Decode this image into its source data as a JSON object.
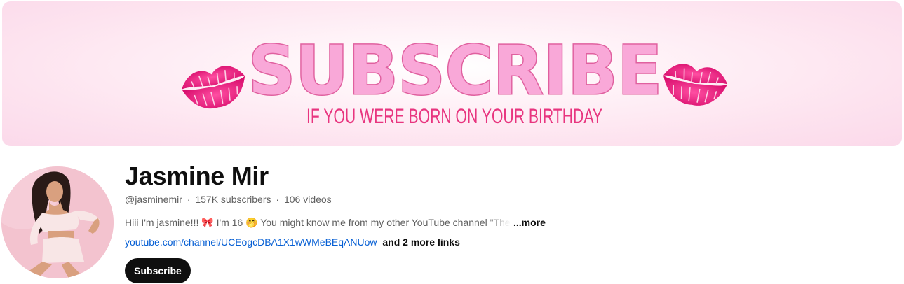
{
  "banner": {
    "headline": "SUBSCRIBE",
    "tagline": "IF YOU WERE BORN ON YOUR BIRTHDAY",
    "colors": {
      "headline_fill": "#f9a8d8",
      "headline_outline": "#e0609f",
      "tagline": "#e8357f",
      "lips": "#e8227e"
    },
    "icons": [
      "lips-icon",
      "lips-icon"
    ]
  },
  "channel": {
    "name": "Jasmine Mir",
    "handle": "@jasminemir",
    "subscribers": "157K subscribers",
    "videos": "106 videos",
    "separator": "·"
  },
  "description": {
    "text": "Hiii I'm jasmine!!! 🎀 I'm 16 🤭 You might know me from my other YouTube channel \"The",
    "more_label": "...more"
  },
  "links": {
    "primary": "youtube.com/channel/UCEogcDBA1X1wWMeBEqANUow",
    "more": "and 2 more links"
  },
  "actions": {
    "subscribe_label": "Subscribe"
  },
  "avatar": {
    "icon": "avatar-photo",
    "background": "#f4c6d2"
  }
}
